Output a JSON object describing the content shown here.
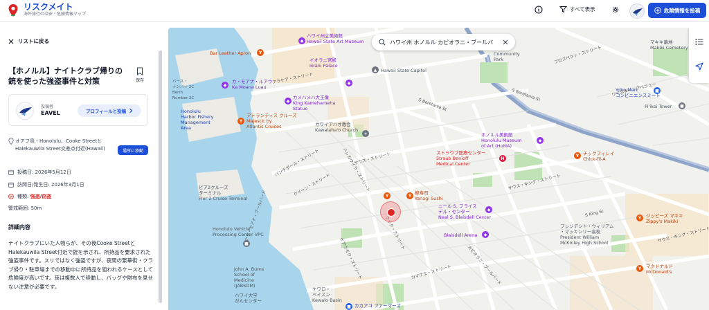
{
  "header": {
    "brand_name": "リスクメイト",
    "brand_tagline": "海外旅行の治安・危険情報マップ",
    "show_all_label": "すべて表示",
    "report_button": "危険情報を投稿"
  },
  "panel": {
    "back_label": "リストに戻る",
    "title": "【ホノルル】ナイトクラブ帰りの銃を使った強盗事件と対策",
    "save_label": "保存",
    "author_label": "投稿者",
    "author_name": "EAVEL",
    "profile_button": "プロフィールと投稿",
    "location": "オアフ島・Honolulu、Cooke StreetとHalekauwila Street交差点付近(Hawaii)",
    "move_button": "場所に移動",
    "posted_date": "投稿日: 2026年5月12日",
    "visit_date": "訪問日/発生日: 2026年3月1日",
    "type_prefix": "種類: ",
    "type_value": "強盗/窃盗",
    "alert_range": "警戒範囲: 50m",
    "section_title": "詳細内容",
    "description": "ナイトクラブにいた人物らが、その後Cooke StreetとHalekauwila Street付近で銃を示され、所持品を要求された強盗事件です。スリではなく強盗ですが、夜間の繁華街・クラブ帰り・駐車場までの移動中に所持品を狙われるケースとして危険度が高いです。夜は複数人で移動し、バッグや財布を見せない注意が必要です。"
  },
  "map": {
    "search_value": "ハワイ州 ホノルル カピオラニ・ブールバ",
    "labels": {
      "hawaii_state_art": "ハワイ州立美術館\nHawaii State Art Museum",
      "bar_leather_apron": "Bar Leather Apron",
      "hawaii_state_capitol": "Hawaii State Capitol",
      "iolani": "イオラニ宮殿\nIolani Palace",
      "kamehameha": "カメハメハ大王像\nKing Kamehameha\nStatue",
      "kamealuamoa": "カ・モアナ・ルアウ\nKa Moana Luau",
      "atlantis": "アトランティス クルーズ\nMajestic by\nAtlantis Cruises",
      "kawaiahao": "カワイアハオ教会\nKawaiaha'o Church",
      "honolulu_museum": "ホノルル美術館\nHonolulu Museum\nof Art (HoMA)",
      "straub": "ストラウブ医療センター\nStraub Benioff\nMedical Center",
      "chick_fil_a": "チックフィレイ\nChick-fil-A",
      "yanagi": "柳寿司\nYanagi Sushi",
      "neal_blaisdell": "ニール S. ブライス\nデル・センター\nNeal S. Blaisdell Center",
      "blaisdell_arena": "Blaisdell Arena",
      "pier2": "ピア2クルーズ\nターミナル\nPier 2 Cruise Terminal",
      "harbor_fishery": "Honolulu\nHarbor Fishery\nManagement\nArea",
      "bus_stop": "バース・\nナンバー 2C\nBerth\nNumber 2C",
      "vehicle_center": "Honolulu Vehicle\nProcessing Center VPC",
      "jabsom": "John A. Burns\nSchool of\nMedicine\n(JABSOM)",
      "kakaako_univ": "ハワイ大学\nがんセンター",
      "kakaako_farmers": "カカアコ ファーマーズ",
      "kewalo": "ケワロ・\nベイスン\nKewalo Basin",
      "yobo_mart": "Yobo Mart\nコンビニエンスミート",
      "piikoi_tower": "Pi'ikoi Tower",
      "makiki_cemetery": "マキキ墓地\nMakiki Cemetery",
      "mcdonalds": "マクドナルド\nMcDonald's",
      "zippys": "ジッピーズ マキキ\nZippy's Makiki",
      "mckinley": "プレジデント・ウィリアム\n・マッキンリー高校\nPresident William\nMcKinley High School",
      "community_park": "Community\nPark"
    },
    "streets": {
      "alakea": "アラケア・ストリート",
      "beretania1": "S Beretania St",
      "beretania2": "S Beretania St",
      "prospect": "プロスペクト・ストリート",
      "wilder": "ワイルダー・アベニュー",
      "punchbowl": "パンチボール・ストリート",
      "queen": "クイーン・ストリート",
      "south": "サウス・ストリート",
      "king": "サウス・キング・ストリート",
      "king2": "サウス・キング・ストリート",
      "s_king": "S King St",
      "halekauwila": "ハレカウイラ・ストリート",
      "ala_moana": "アラ・モアナ・ブールバード",
      "kapiolani": "カピオラニ・ブールバード",
      "cooke": "クック・ストリート",
      "kamakee": "カマケエ・ストリート",
      "keeaumoku": "ケアウモク・ストリート"
    }
  }
}
